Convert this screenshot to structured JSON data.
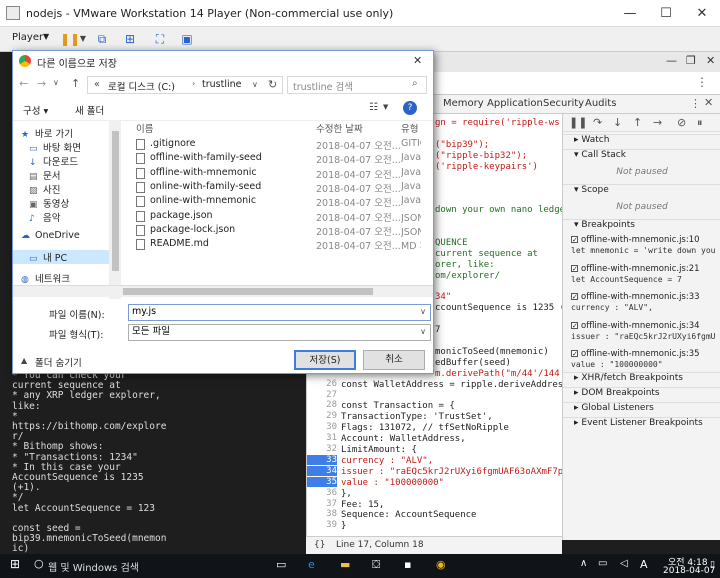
{
  "vm": {
    "title": "nodejs - VMware Workstation 14 Player (Non-commercial use only)",
    "player_label": "Player"
  },
  "devtools": {
    "tabs": [
      "Memory",
      "Application",
      "Security",
      "Audits"
    ],
    "status": "Line 17, Column 18",
    "braces": "{}"
  },
  "code_lines": [
    {
      "ln": "",
      "t": "gn = require('ripple-ws"
    },
    {
      "ln": "",
      "t": ""
    },
    {
      "ln": "",
      "t": "(\"bip39\");"
    },
    {
      "ln": "",
      "t": "(\"ripple-bip32\");"
    },
    {
      "ln": "",
      "t": "('ripple-keypairs')"
    },
    {
      "ln": "",
      "t": ""
    },
    {
      "ln": "",
      "t": ""
    },
    {
      "ln": "",
      "t": ""
    },
    {
      "ln": "",
      "t": "down your own nano ledger"
    },
    {
      "ln": "",
      "t": ""
    },
    {
      "ln": "",
      "t": ""
    },
    {
      "ln": "",
      "t": "QUENCE"
    },
    {
      "ln": "",
      "t": "current sequence at"
    },
    {
      "ln": "",
      "t": "orer, like:"
    },
    {
      "ln": "",
      "t": "om/explorer/"
    },
    {
      "ln": "",
      "t": ""
    },
    {
      "ln": "",
      "t": "34\""
    },
    {
      "ln": "",
      "t": "ccountSequence is 1235 (+"
    },
    {
      "ln": "",
      "t": ""
    },
    {
      "ln": "",
      "t": "7"
    },
    {
      "ln": "",
      "t": ""
    },
    {
      "ln": "",
      "t": "monicToSeed(mnemonic)"
    },
    {
      "ln": "",
      "t": "edBuffer(seed)"
    },
    {
      "ln": "",
      "t": "m.derivePath(\"m/44'/144'/"
    },
    {
      "ln": "26",
      "t": "const WalletAddress = ripple.deriveAddress(Seed"
    },
    {
      "ln": "27",
      "t": ""
    },
    {
      "ln": "28",
      "t": "const Transaction = {"
    },
    {
      "ln": "29",
      "t": "  TransactionType: 'TrustSet',"
    },
    {
      "ln": "30",
      "t": "  Flags: 131072, // tfSetNoRipple"
    },
    {
      "ln": "31",
      "t": "  Account: WalletAddress,"
    },
    {
      "ln": "32",
      "t": "  LimitAmount: {"
    },
    {
      "ln": "33",
      "t": "    currency : \"ALV\","
    },
    {
      "ln": "34",
      "t": "    issuer : \"raEQc5krJ2rUXyi6fgmUAF63oAXmF7p6j"
    },
    {
      "ln": "35",
      "t": "    value : \"100000000\""
    },
    {
      "ln": "36",
      "t": "  },"
    },
    {
      "ln": "37",
      "t": "  Fee: 15,"
    },
    {
      "ln": "38",
      "t": "  Sequence: AccountSequence"
    },
    {
      "ln": "39",
      "t": "}"
    }
  ],
  "debugger": {
    "watch": "Watch",
    "call_stack": "Call Stack",
    "not_paused": "Not paused",
    "scope": "Scope",
    "not_paused2": "Not paused",
    "breakpoints": "Breakpoints",
    "bp_items": [
      {
        "file": "offline-with-mnemonic.js:10",
        "code": "let mnemonic = 'write down you"
      },
      {
        "file": "offline-with-mnemonic.js:21",
        "code": "let AccountSequence = 7"
      },
      {
        "file": "offline-with-mnemonic.js:33",
        "code": "currency : \"ALV\","
      },
      {
        "file": "offline-with-mnemonic.js:34",
        "code": "issuer : \"raEQc5krJ2rUXyi6fgmU"
      },
      {
        "file": "offline-with-mnemonic.js:35",
        "code": "value : \"100000000\""
      }
    ],
    "xhr": "XHR/fetch Breakpoints",
    "dom": "DOM Breakpoints",
    "global": "Global Listeners",
    "event": "Event Listener Breakpoints"
  },
  "console_lines": [
    " * You can check your",
    "current sequence at",
    "  * any XRP ledger explorer,",
    "like:",
    "  *",
    "https://bithomp.com/explore",
    "r/",
    "  * Bithomp shows:",
    "  *   \"Transactions: 1234\"",
    "  * In this case your",
    "AccountSequence is 1235",
    "(+1).",
    "  */",
    "let AccountSequence = 123",
    "",
    "const seed =",
    "bip39.mnemonicToSeed(mnemon",
    "ic)"
  ],
  "dialog": {
    "title": "다른 이름으로 저장",
    "path": [
      "로컬 디스크 (C:)",
      "trustline"
    ],
    "path_prefix": "«",
    "search_placeholder": "trustline 검색",
    "organize": "구성 ▾",
    "new_folder": "새 폴더",
    "tree": [
      "바로 가기",
      "바탕 화면",
      "다운로드",
      "문서",
      "사진",
      "동영상",
      "음악",
      "OneDrive",
      "내 PC",
      "네트워크"
    ],
    "headers": [
      "이름",
      "수정한 날짜",
      "유형"
    ],
    "files": [
      {
        "name": ".gitignore",
        "date": "2018-04-07 오전...",
        "type": "GITIGNORE"
      },
      {
        "name": "offline-with-family-seed",
        "date": "2018-04-07 오전...",
        "type": "JavaScript"
      },
      {
        "name": "offline-with-mnemonic",
        "date": "2018-04-07 오전...",
        "type": "JavaScript"
      },
      {
        "name": "online-with-family-seed",
        "date": "2018-04-07 오전...",
        "type": "JavaScript"
      },
      {
        "name": "online-with-mnemonic",
        "date": "2018-04-07 오전...",
        "type": "JavaScript"
      },
      {
        "name": "package.json",
        "date": "2018-04-07 오전...",
        "type": "JSON 파일"
      },
      {
        "name": "package-lock.json",
        "date": "2018-04-07 오전...",
        "type": "JSON 파일"
      },
      {
        "name": "README.md",
        "date": "2018-04-07 오전...",
        "type": "MD 파일"
      }
    ],
    "filename_label": "파일 이름(N):",
    "filename_value": "my.js",
    "filetype_label": "파일 형식(T):",
    "filetype_value": "모든 파일",
    "hide_folders": "폴더 숨기기",
    "save": "저장(S)",
    "cancel": "취소"
  },
  "taskbar": {
    "search": "웹 및 Windows 검색",
    "time": "오전 4:18",
    "date": "2018-04-07",
    "ime": "A"
  }
}
